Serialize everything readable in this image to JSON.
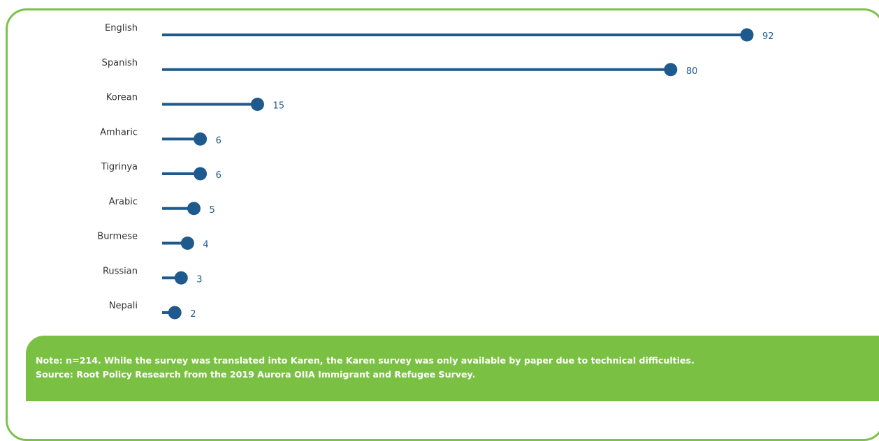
{
  "colors": {
    "accent": "#1f5a8e",
    "frame": "#7dc14b",
    "note_bg": "#7ac143",
    "note_text": "#ffffff",
    "label_text": "#333333"
  },
  "chart_data": {
    "type": "bar",
    "style": "lollipop",
    "orientation": "horizontal",
    "categories": [
      "English",
      "Spanish",
      "Korean",
      "Amharic",
      "Tigrinya",
      "Arabic",
      "Burmese",
      "Russian",
      "Nepali"
    ],
    "values": [
      92,
      80,
      15,
      6,
      6,
      5,
      4,
      3,
      2
    ],
    "data_labels": [
      "92",
      "80",
      "15",
      "6",
      "6",
      "5",
      "4",
      "3",
      "2"
    ],
    "title": "",
    "xlabel": "",
    "ylabel": "",
    "xlim": [
      0,
      92
    ],
    "grid": false,
    "legend": "none"
  },
  "note": {
    "line1": "Note: n=214. While the survey was translated into Karen, the Karen survey was only available by paper due to technical difficulties.",
    "line2": "Source: Root Policy Research from the 2019 Aurora OIIA Immigrant and Refugee Survey."
  }
}
